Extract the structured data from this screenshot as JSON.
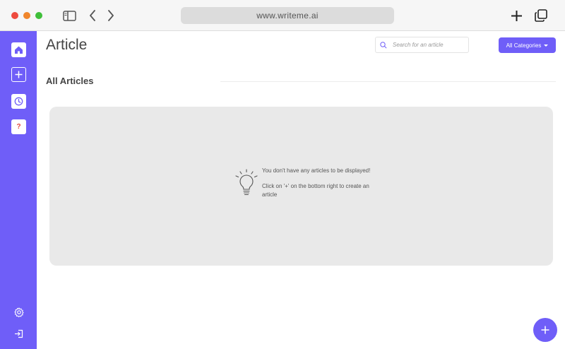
{
  "browser": {
    "url": "www.writeme.ai",
    "icons": [
      "sidebar-toggle-icon",
      "back-arrow-icon",
      "forward-arrow-icon",
      "new-tab-plus-icon",
      "tabs-overview-icon"
    ]
  },
  "sidebar": {
    "items": [
      {
        "name": "home",
        "icon": "home-icon",
        "active": true
      },
      {
        "name": "create",
        "icon": "plus-icon"
      },
      {
        "name": "history",
        "icon": "clock-icon"
      },
      {
        "name": "help",
        "icon": "help-icon",
        "glyph": "?"
      }
    ],
    "bottom_items": [
      {
        "name": "settings",
        "icon": "gear-icon"
      },
      {
        "name": "logout",
        "icon": "logout-icon"
      }
    ]
  },
  "header": {
    "title": "Article",
    "search_placeholder": "Search for an article",
    "category_button": "All Categories"
  },
  "section": {
    "title": "All Articles"
  },
  "empty_state": {
    "icon": "lightbulb-icon",
    "message": "You don't have any articles to be displayed!",
    "hint": "Click on '+' on the bottom right to create an article"
  },
  "colors": {
    "accent": "#6f5ef8",
    "panel": "#e9e9e9",
    "help_glyph": "#e2483d"
  }
}
